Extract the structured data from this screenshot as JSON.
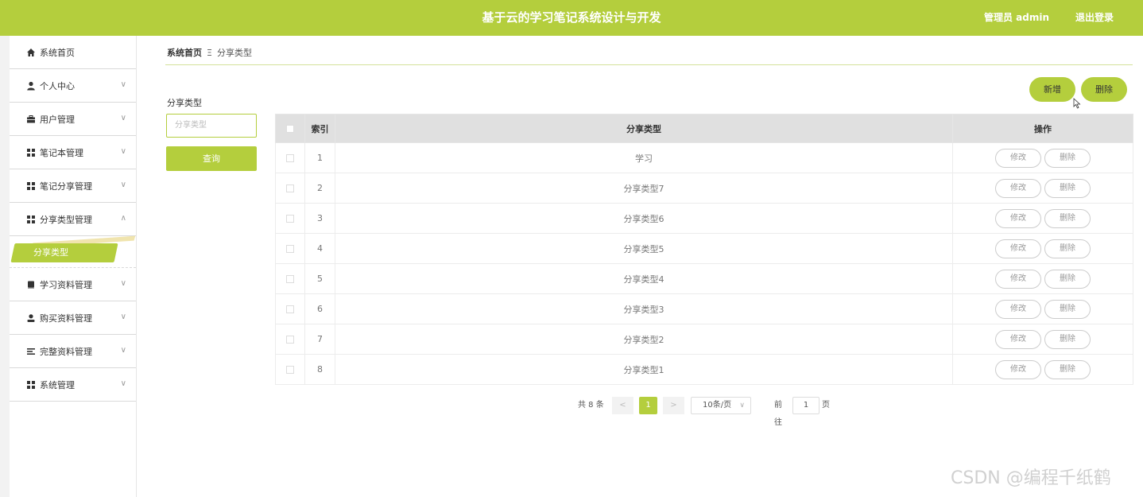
{
  "header": {
    "title": "基于云的学习笔记系统设计与开发",
    "admin": "管理员 admin",
    "logout": "退出登录"
  },
  "sidebar": {
    "items": [
      {
        "label": "系统首页",
        "icon": "home-icon"
      },
      {
        "label": "个人中心",
        "icon": "person-icon"
      },
      {
        "label": "用户管理",
        "icon": "briefcase-icon"
      },
      {
        "label": "笔记本管理",
        "icon": "grid-icon"
      },
      {
        "label": "笔记分享管理",
        "icon": "grid-icon"
      },
      {
        "label": "分享类型管理",
        "icon": "grid-icon",
        "expanded": true
      },
      {
        "label": "学习资料管理",
        "icon": "book-icon"
      },
      {
        "label": "购买资料管理",
        "icon": "user-icon"
      },
      {
        "label": "完整资料管理",
        "icon": "list-icon"
      },
      {
        "label": "系统管理",
        "icon": "grid-icon"
      }
    ],
    "sub_active": "分享类型"
  },
  "breadcrumb": {
    "home": "系统首页",
    "separator": "Ξ",
    "current": "分享类型"
  },
  "filter": {
    "label": "分享类型",
    "placeholder": "分享类型",
    "search_button": "查询"
  },
  "actions": {
    "add": "新增",
    "delete": "删除"
  },
  "table": {
    "headers": {
      "index": "索引",
      "type": "分享类型",
      "ops": "操作"
    },
    "rows": [
      {
        "index": "1",
        "type": "学习"
      },
      {
        "index": "2",
        "type": "分享类型7"
      },
      {
        "index": "3",
        "type": "分享类型6"
      },
      {
        "index": "4",
        "type": "分享类型5"
      },
      {
        "index": "5",
        "type": "分享类型4"
      },
      {
        "index": "6",
        "type": "分享类型3"
      },
      {
        "index": "7",
        "type": "分享类型2"
      },
      {
        "index": "8",
        "type": "分享类型1"
      }
    ],
    "row_edit": "修改",
    "row_delete": "删除"
  },
  "pagination": {
    "total": "共 8 条",
    "prev": "<",
    "current": "1",
    "next": ">",
    "page_size": "10条/页",
    "goto": "前往",
    "goto_value": "1",
    "page_suffix": "页"
  },
  "watermark": "CSDN @编程千纸鹤",
  "colors": {
    "accent": "#b4ce3d"
  }
}
